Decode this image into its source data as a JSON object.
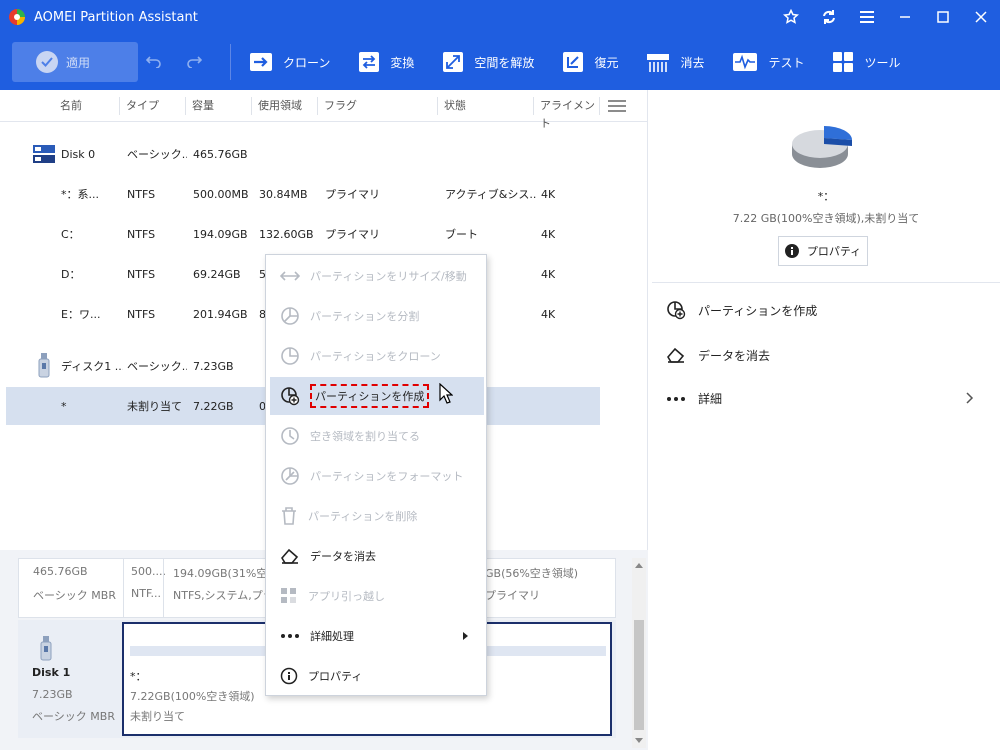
{
  "window": {
    "title": "AOMEI Partition Assistant"
  },
  "toolbar": {
    "apply": "適用",
    "items": [
      "クローン",
      "変換",
      "空間を解放",
      "復元",
      "消去",
      "テスト",
      "ツール"
    ]
  },
  "table": {
    "headers": [
      "名前",
      "タイプ",
      "容量",
      "使用領域",
      "フラグ",
      "状態",
      "アライメント"
    ],
    "rows": [
      {
        "name": "Disk 0",
        "type": "ベーシック...",
        "capacity": "465.76GB",
        "used": "",
        "flag": "",
        "status": "",
        "align": ""
      },
      {
        "name": "*：系...",
        "type": "NTFS",
        "capacity": "500.00MB",
        "used": "30.84MB",
        "flag": "プライマリ",
        "status": "アクティブ&シス...",
        "align": "4K"
      },
      {
        "name": "C：",
        "type": "NTFS",
        "capacity": "194.09GB",
        "used": "132.60GB",
        "flag": "プライマリ",
        "status": "ブート",
        "align": "4K"
      },
      {
        "name": "D：",
        "type": "NTFS",
        "capacity": "69.24GB",
        "used": "5",
        "flag": "",
        "status": "",
        "align": "4K"
      },
      {
        "name": "E：ワ...",
        "type": "NTFS",
        "capacity": "201.94GB",
        "used": "8",
        "flag": "",
        "status": "",
        "align": "4K"
      },
      {
        "name": "ディスク1 ...",
        "type": "ベーシック...",
        "capacity": "7.23GB",
        "used": "",
        "flag": "",
        "status": "",
        "align": ""
      },
      {
        "name": "*",
        "type": "未割り当て",
        "capacity": "7.22GB",
        "used": "0",
        "flag": "",
        "status": "",
        "align": ""
      }
    ]
  },
  "diskmap": {
    "disk0": {
      "size": "465.76GB",
      "kind": "ベーシック MBR",
      "p1_size": "500....",
      "p1_fs": "NTF...",
      "p2_size": "194.09GB(31%空き領域)",
      "p2_fs": "NTFS,システム,プライ",
      "p3_size": "GB(56%空き領域)",
      "p3_fs": "プライマリ"
    },
    "disk1": {
      "name": "Disk 1",
      "size": "7.23GB",
      "kind": "ベーシック MBR",
      "part_name": "*：",
      "part_size": "7.22GB(100%空き領域)",
      "part_status": "未割り当て"
    }
  },
  "right_panel": {
    "title": "*：",
    "info": "7.22 GB(100%空き領域),未割り当て",
    "properties_btn": "プロパティ",
    "actions": [
      "パーティションを作成",
      "データを消去",
      "詳細"
    ]
  },
  "context_menu": {
    "items": [
      {
        "label": "パーティションをリサイズ/移動",
        "enabled": false
      },
      {
        "label": "パーティションを分割",
        "enabled": false
      },
      {
        "label": "パーティションをクローン",
        "enabled": false
      },
      {
        "label": "パーティションを作成",
        "enabled": true
      },
      {
        "label": "空き領域を割り当てる",
        "enabled": false
      },
      {
        "label": "パーティションをフォーマット",
        "enabled": false
      },
      {
        "label": "パーティションを削除",
        "enabled": false
      },
      {
        "label": "データを消去",
        "enabled": true
      },
      {
        "label": "アプリ引っ越し",
        "enabled": false
      },
      {
        "label": "詳細処理",
        "enabled": true
      },
      {
        "label": "プロパティ",
        "enabled": true
      }
    ]
  },
  "colors": {
    "brand_blue": "#1f5ee0",
    "selection": "#d6e0ef",
    "highlight_border": "#e00000"
  }
}
